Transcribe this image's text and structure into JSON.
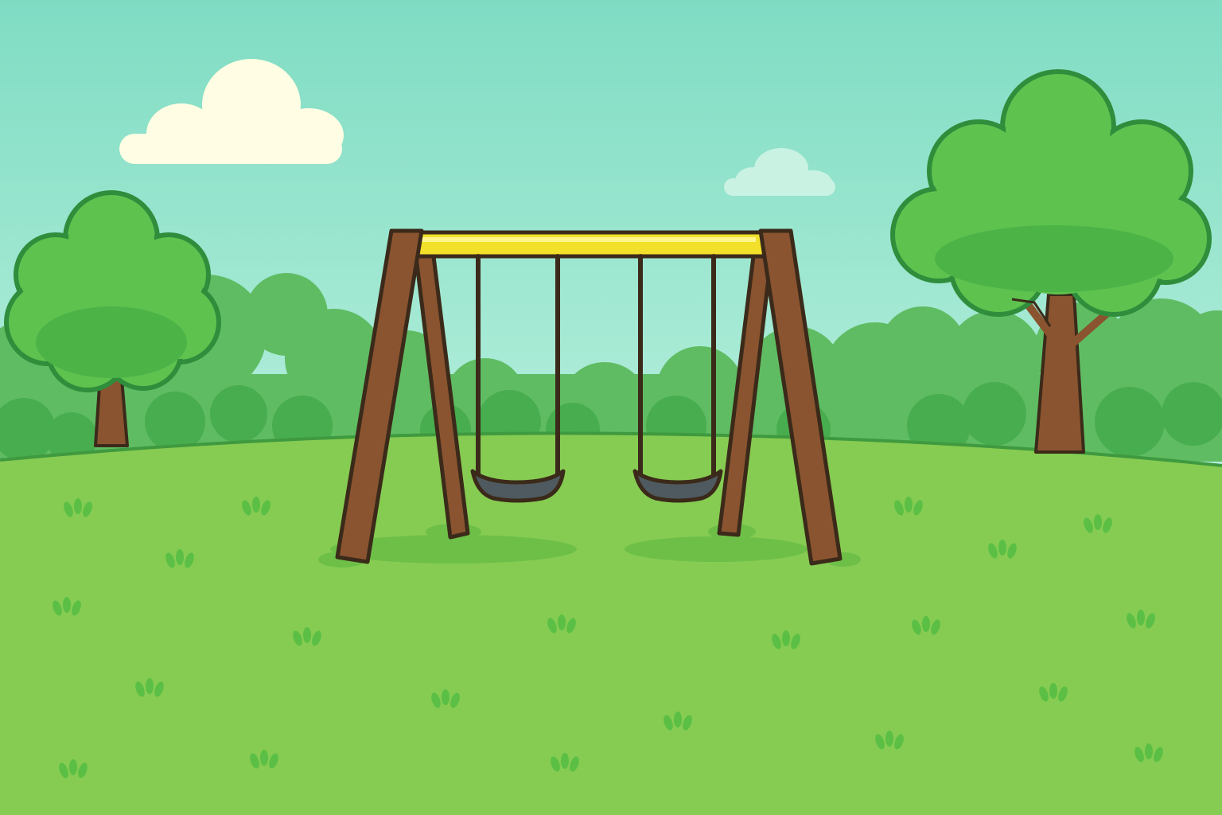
{
  "scene": {
    "description_tags": [
      "sky",
      "clouds",
      "bushes",
      "trees",
      "grass",
      "swing-set"
    ],
    "colors": {
      "sky_top": "#7fdcc3",
      "sky_bottom": "#b5efdb",
      "cloud": "#fffde3",
      "cloud_faint": "#c9f2e2",
      "bush_back": "#5fbc63",
      "bush_front": "#48ad4e",
      "grass": "#86cc52",
      "grass_tuft": "#5bbf45",
      "tree_canopy": "#5ec24f",
      "tree_canopy_shade": "#4cb347",
      "tree_outline": "#2f8d3b",
      "trunk": "#8a5430",
      "frame_wood": "#8a5430",
      "top_bar": "#f2e02a",
      "outline": "#3b2a1a",
      "seat": "#4f5a60",
      "shadow": "#6dbf48"
    },
    "swing_count": 2,
    "tree_count": 2
  }
}
